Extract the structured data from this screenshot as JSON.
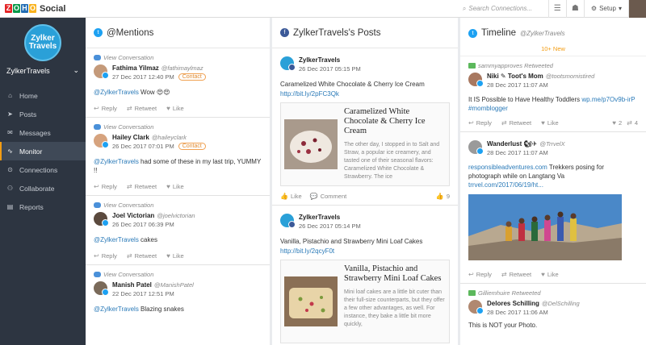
{
  "topbar": {
    "brand": "Social",
    "zoho_letters": [
      "Z",
      "O",
      "H",
      "O"
    ],
    "search_placeholder": "Search Connections...",
    "setup_label": "Setup"
  },
  "sidebar": {
    "logo_text_1": "Zylker",
    "logo_text_2": "Travels",
    "account_name": "ZylkerTravels",
    "items": [
      {
        "label": "Home",
        "icon": "home-icon"
      },
      {
        "label": "Posts",
        "icon": "send-icon"
      },
      {
        "label": "Messages",
        "icon": "mail-icon"
      },
      {
        "label": "Monitor",
        "icon": "pulse-icon",
        "active": true
      },
      {
        "label": "Connections",
        "icon": "connections-icon"
      },
      {
        "label": "Collaborate",
        "icon": "collaborate-icon"
      },
      {
        "label": "Reports",
        "icon": "reports-icon"
      }
    ]
  },
  "mentions": {
    "title": "@Mentions",
    "view_conversation": "View Conversation",
    "reply": "Reply",
    "retweet": "Retweet",
    "like": "Like",
    "posts": [
      {
        "name": "Fathima Yilmaz",
        "handle": "@fathimaylmaz",
        "date": "27 Dec 2017 12:40 PM",
        "badge": "Contact",
        "mention": "@ZylkerTravels",
        "text": " Wow 😍😍"
      },
      {
        "name": "Hailey Clark",
        "handle": "@haileyclark",
        "date": "26 Dec 2017 07:01 PM",
        "badge": "Contact",
        "mention": "@ZylkerTravels",
        "text": " had some of these in my last trip, YUMMY !!"
      },
      {
        "name": "Joel Victorian",
        "handle": "@joelvictorian",
        "date": "26 Dec 2017 06:39 PM",
        "badge": "",
        "mention": "@ZylkerTravels",
        "text": " cakes"
      },
      {
        "name": "Manish Patel",
        "handle": "@ManishPatel",
        "date": "22 Dec 2017 12:51 PM",
        "badge": "",
        "mention": "@ZylkerTravels",
        "text": " Blazing snakes"
      }
    ]
  },
  "facebook": {
    "title": "ZylkerTravels's Posts",
    "like": "Like",
    "comment": "Comment",
    "posts": [
      {
        "name": "ZylkerTravels",
        "date": "26 Dec 2017 05:15 PM",
        "text": "Caramelized White Chocolate & Cherry Ice Cream",
        "link": "http://bit.ly/2pFC3Qk",
        "card_title": "Caramelized White Chocolate & Cherry Ice Cream",
        "card_desc": "The other day, I stopped in to Salt and Straw, a popular ice creamery, and tasted one of their seasonal flavors: Caramelized White Chocolate & Strawberry. The ice",
        "likes": "9"
      },
      {
        "name": "ZylkerTravels",
        "date": "26 Dec 2017 05:14 PM",
        "text": "Vanilla, Pistachio and Strawberry Mini Loaf Cakes",
        "link": "http://bit.ly/2qcyF0t",
        "card_title": "Vanilla, Pistachio and Strawberry Mini Loaf Cakes",
        "card_desc": "Mini loaf cakes are a little bit cuter than their full-size counterparts, but they offer a few other advantages, as well. For instance, they bake a little bit more quickly,",
        "likes": ""
      }
    ]
  },
  "timeline": {
    "title": "Timeline",
    "handle": "@ZylkerTravels",
    "new_label": "10+ New",
    "reply": "Reply",
    "retweet": "Retweet",
    "like": "Like",
    "posts": [
      {
        "retweeted_by": "sammyapproves Retweeted",
        "name": "Niki ✎ Toot's Mom",
        "handle": "@tootsmomistired",
        "date": "28 Dec 2017 11:07 AM",
        "text": "It IS Possible to Have Healthy Toddlers ",
        "link": "wp.me/p7Ov9b-irP #momblogger",
        "likes": "2",
        "retweets": "4"
      },
      {
        "retweeted_by": "",
        "name": "Wanderlust 🐿✈",
        "handle": "@TrrvelX",
        "date": "28 Dec 2017 11:07 AM",
        "link_pre": "responsibleadventures.com",
        "text": " Trekkers posing for photograph while on Langtang Va ",
        "link": "trrvel.com/2017/06/19/ht...",
        "likes": "",
        "retweets": ""
      },
      {
        "retweeted_by": "Gilliemhuire Retweeted",
        "name": "Delores Schilling",
        "handle": "@DelSchilling",
        "date": "28 Dec 2017 11:06 AM",
        "text": "This is NOT your Photo.",
        "link": "",
        "likes": "",
        "retweets": ""
      }
    ]
  }
}
